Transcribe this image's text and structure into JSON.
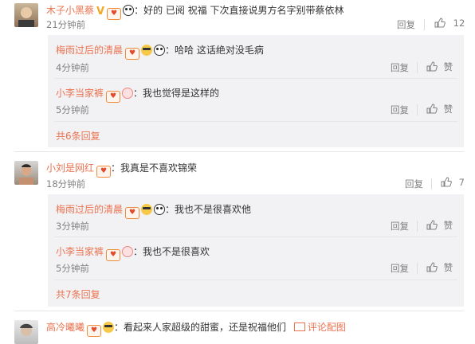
{
  "colors": {
    "name": "#eb7350",
    "text": "#333333",
    "muted": "#808080",
    "reply_bg": "#f2f2f5"
  },
  "comments": [
    {
      "user": "木子小黑蔡",
      "text": "：好的 已阅 祝福 下次直接说男方名字别带蔡依林",
      "time": "21分钟前",
      "reply_label": "回复",
      "like_count": "12",
      "replies": [
        {
          "user": "梅雨过后的清晨",
          "text": "：哈哈 这话绝对没毛病",
          "time": "4分钟前",
          "reply_label": "回复",
          "like_label": "赞"
        },
        {
          "user": "小李当家裤",
          "text": "：我也觉得是这样的",
          "time": "5分钟前",
          "reply_label": "回复",
          "like_label": "赞"
        }
      ],
      "more": "共6条回复"
    },
    {
      "user": "小刘是网红",
      "text": "：我真是不喜欢锦荣",
      "time": "18分钟前",
      "reply_label": "回复",
      "like_count": "7",
      "replies": [
        {
          "user": "梅雨过后的清晨",
          "text": "：我也不是很喜欢他",
          "time": "3分钟前",
          "reply_label": "回复",
          "like_label": "赞"
        },
        {
          "user": "小李当家裤",
          "text": "：我也不是很喜欢",
          "time": "5分钟前",
          "reply_label": "回复",
          "like_label": "赞"
        }
      ],
      "more": "共7条回复"
    },
    {
      "user": "高冷曦曦",
      "text": "：看起来人家超级的甜蜜，还是祝福他们",
      "pic_label": "评论配图"
    }
  ]
}
